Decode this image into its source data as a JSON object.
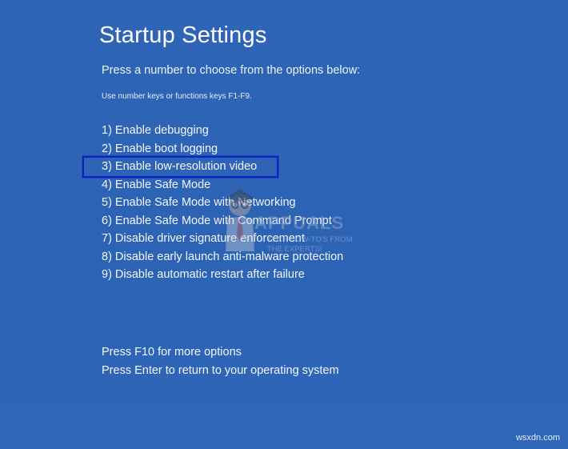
{
  "header": {
    "title": "Startup Settings",
    "subtitle": "Press a number to choose from the options below:",
    "hint": "Use number keys or functions keys F1-F9."
  },
  "options": [
    {
      "label": "1) Enable debugging"
    },
    {
      "label": "2) Enable boot logging"
    },
    {
      "label": "3) Enable low-resolution video"
    },
    {
      "label": "4) Enable Safe Mode"
    },
    {
      "label": "5) Enable Safe Mode with Networking"
    },
    {
      "label": "6) Enable Safe Mode with Command Prompt"
    },
    {
      "label": "7) Disable driver signature enforcement"
    },
    {
      "label": "8) Disable early launch anti-malware protection"
    },
    {
      "label": "9) Disable automatic restart after failure"
    }
  ],
  "footer": {
    "more_options": "Press F10 for more options",
    "return": "Press Enter to return to your operating system"
  },
  "watermark": {
    "brand": "APPUALS",
    "tagline": "TECH HOW-TO'S FROM THE EXPERTS!"
  },
  "site_mark": "wsxdn.com",
  "colors": {
    "background": "#2f65b5",
    "highlight_border": "#0a22c8",
    "text": "#ffffff"
  }
}
